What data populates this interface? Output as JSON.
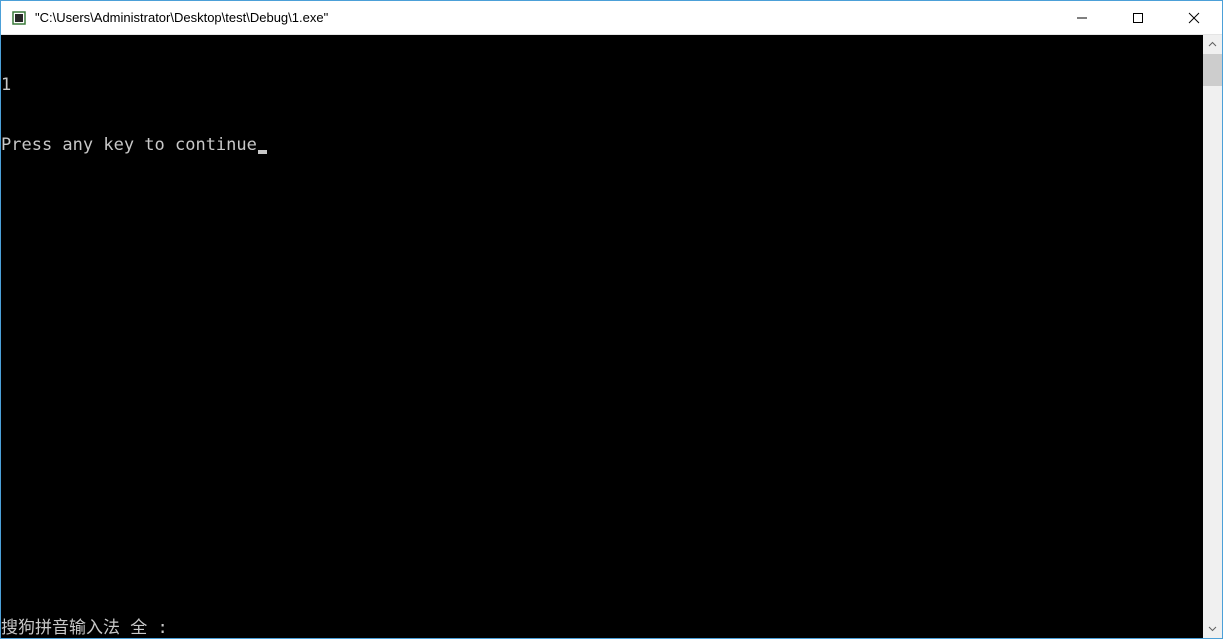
{
  "window": {
    "title": "\"C:\\Users\\Administrator\\Desktop\\test\\Debug\\1.exe\""
  },
  "console": {
    "lines": [
      "1",
      "Press any key to continue"
    ],
    "ime_status": "搜狗拼音输入法 全 :"
  }
}
